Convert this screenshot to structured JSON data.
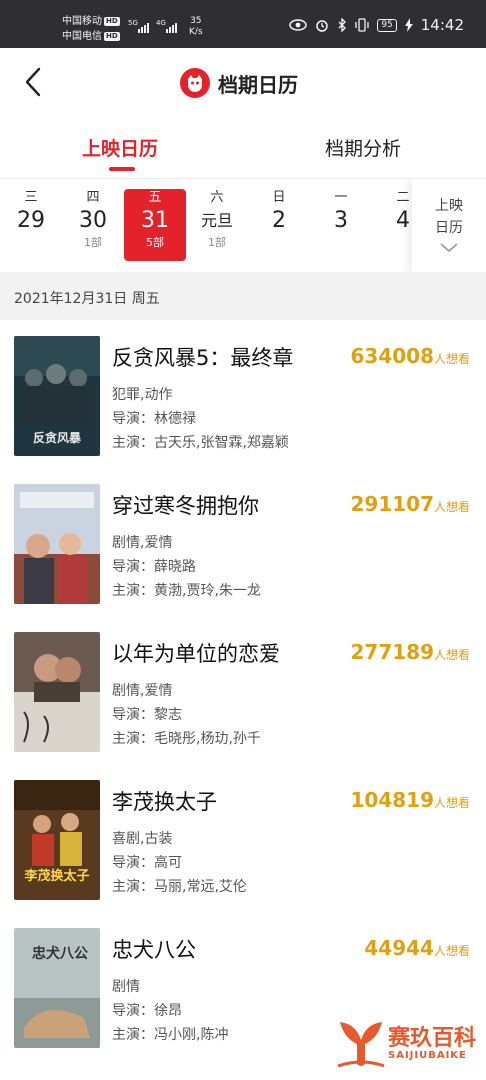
{
  "status_bar": {
    "carrier1": "中国移动",
    "carrier2": "中国电信",
    "hd": "HD",
    "net_5g": "5G",
    "net_4g": "4G",
    "speed_value": "35",
    "speed_unit": "K/s",
    "battery": "95",
    "time": "14:42"
  },
  "header": {
    "title": "档期日历"
  },
  "tabs": [
    {
      "label": "上映日历",
      "active": true
    },
    {
      "label": "档期分析",
      "active": false
    }
  ],
  "dates": [
    {
      "weekday": "三",
      "day": "29",
      "count": ""
    },
    {
      "weekday": "四",
      "day": "30",
      "count": "1部"
    },
    {
      "weekday": "五",
      "day": "31",
      "count": "5部",
      "selected": true
    },
    {
      "weekday": "六",
      "day": "元旦",
      "count": "1部"
    },
    {
      "weekday": "日",
      "day": "2",
      "count": ""
    },
    {
      "weekday": "一",
      "day": "3",
      "count": ""
    },
    {
      "weekday": "二",
      "day": "4",
      "count": ""
    }
  ],
  "date_more": {
    "line1": "上映",
    "line2": "日历"
  },
  "selected_date_label": "2021年12月31日 周五",
  "want_unit": "人想看",
  "movies": [
    {
      "title": "反贪风暴5：最终章",
      "want": "634008",
      "genre": "犯罪,动作",
      "director": "导演：林德禄",
      "cast": "主演：古天乐,张智霖,郑嘉颖",
      "poster_color": "#1f3640",
      "poster_text": "反贪风暴"
    },
    {
      "title": "穿过寒冬拥抱你",
      "want": "291107",
      "genre": "剧情,爱情",
      "director": "导演：薛晓路",
      "cast": "主演：黄渤,贾玲,朱一龙",
      "poster_color": "#c9d4e0",
      "poster_text": ""
    },
    {
      "title": "以年为单位的恋爱",
      "want": "277189",
      "genre": "剧情,爱情",
      "director": "导演：黎志",
      "cast": "主演：毛晓彤,杨玏,孙千",
      "poster_color": "#d9d4cc",
      "poster_text": ""
    },
    {
      "title": "李茂换太子",
      "want": "104819",
      "genre": "喜剧,古装",
      "director": "导演：高可",
      "cast": "主演：马丽,常远,艾伦",
      "poster_color": "#5a3a1e",
      "poster_text": "李茂换太子"
    },
    {
      "title": "忠犬八公",
      "want": "44944",
      "genre": "剧情",
      "director": "导演：徐昂",
      "cast": "主演：冯小刚,陈冲",
      "poster_color": "#b8c4c4",
      "poster_text": "忠犬八公"
    }
  ],
  "watermark": {
    "title": "赛玖百科",
    "subtitle": "SAIJIUBAIKE"
  },
  "colors": {
    "accent": "#e3222c",
    "want": "#e0a012",
    "status_bar": "#2f2f33"
  }
}
